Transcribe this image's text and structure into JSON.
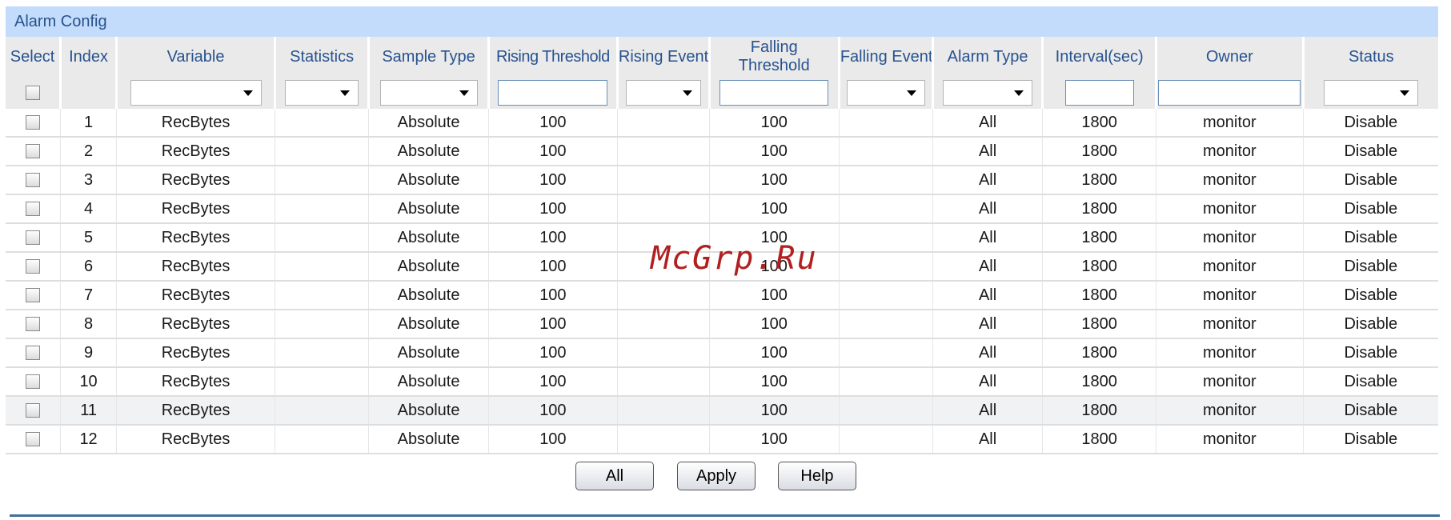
{
  "panel": {
    "title": "Alarm Config"
  },
  "columns": {
    "select": "Select",
    "index": "Index",
    "variable": "Variable",
    "statistics": "Statistics",
    "sample_type": "Sample Type",
    "rising_threshold": "Rising Threshold",
    "rising_event": "Rising Event",
    "falling_threshold_1": "Falling",
    "falling_threshold_2": "Threshold",
    "falling_event": "Falling Event",
    "alarm_type": "Alarm Type",
    "interval": "Interval(sec)",
    "owner": "Owner",
    "status": "Status"
  },
  "filters": {
    "variable": "",
    "statistics": "",
    "sample_type": "",
    "rising_threshold": "",
    "rising_event": "",
    "falling_threshold": "",
    "falling_event": "",
    "alarm_type": "",
    "interval": "",
    "owner": "",
    "status": ""
  },
  "rows": [
    {
      "index": "1",
      "variable": "RecBytes",
      "statistics": "",
      "sample_type": "Absolute",
      "rising_threshold": "100",
      "rising_event": "",
      "falling_threshold": "100",
      "falling_event": "",
      "alarm_type": "All",
      "interval": "1800",
      "owner": "monitor",
      "status": "Disable"
    },
    {
      "index": "2",
      "variable": "RecBytes",
      "statistics": "",
      "sample_type": "Absolute",
      "rising_threshold": "100",
      "rising_event": "",
      "falling_threshold": "100",
      "falling_event": "",
      "alarm_type": "All",
      "interval": "1800",
      "owner": "monitor",
      "status": "Disable"
    },
    {
      "index": "3",
      "variable": "RecBytes",
      "statistics": "",
      "sample_type": "Absolute",
      "rising_threshold": "100",
      "rising_event": "",
      "falling_threshold": "100",
      "falling_event": "",
      "alarm_type": "All",
      "interval": "1800",
      "owner": "monitor",
      "status": "Disable"
    },
    {
      "index": "4",
      "variable": "RecBytes",
      "statistics": "",
      "sample_type": "Absolute",
      "rising_threshold": "100",
      "rising_event": "",
      "falling_threshold": "100",
      "falling_event": "",
      "alarm_type": "All",
      "interval": "1800",
      "owner": "monitor",
      "status": "Disable"
    },
    {
      "index": "5",
      "variable": "RecBytes",
      "statistics": "",
      "sample_type": "Absolute",
      "rising_threshold": "100",
      "rising_event": "",
      "falling_threshold": "100",
      "falling_event": "",
      "alarm_type": "All",
      "interval": "1800",
      "owner": "monitor",
      "status": "Disable"
    },
    {
      "index": "6",
      "variable": "RecBytes",
      "statistics": "",
      "sample_type": "Absolute",
      "rising_threshold": "100",
      "rising_event": "",
      "falling_threshold": "100",
      "falling_event": "",
      "alarm_type": "All",
      "interval": "1800",
      "owner": "monitor",
      "status": "Disable"
    },
    {
      "index": "7",
      "variable": "RecBytes",
      "statistics": "",
      "sample_type": "Absolute",
      "rising_threshold": "100",
      "rising_event": "",
      "falling_threshold": "100",
      "falling_event": "",
      "alarm_type": "All",
      "interval": "1800",
      "owner": "monitor",
      "status": "Disable"
    },
    {
      "index": "8",
      "variable": "RecBytes",
      "statistics": "",
      "sample_type": "Absolute",
      "rising_threshold": "100",
      "rising_event": "",
      "falling_threshold": "100",
      "falling_event": "",
      "alarm_type": "All",
      "interval": "1800",
      "owner": "monitor",
      "status": "Disable"
    },
    {
      "index": "9",
      "variable": "RecBytes",
      "statistics": "",
      "sample_type": "Absolute",
      "rising_threshold": "100",
      "rising_event": "",
      "falling_threshold": "100",
      "falling_event": "",
      "alarm_type": "All",
      "interval": "1800",
      "owner": "monitor",
      "status": "Disable"
    },
    {
      "index": "10",
      "variable": "RecBytes",
      "statistics": "",
      "sample_type": "Absolute",
      "rising_threshold": "100",
      "rising_event": "",
      "falling_threshold": "100",
      "falling_event": "",
      "alarm_type": "All",
      "interval": "1800",
      "owner": "monitor",
      "status": "Disable"
    },
    {
      "index": "11",
      "variable": "RecBytes",
      "statistics": "",
      "sample_type": "Absolute",
      "rising_threshold": "100",
      "rising_event": "",
      "falling_threshold": "100",
      "falling_event": "",
      "alarm_type": "All",
      "interval": "1800",
      "owner": "monitor",
      "status": "Disable",
      "highlighted": true
    },
    {
      "index": "12",
      "variable": "RecBytes",
      "statistics": "",
      "sample_type": "Absolute",
      "rising_threshold": "100",
      "rising_event": "",
      "falling_threshold": "100",
      "falling_event": "",
      "alarm_type": "All",
      "interval": "1800",
      "owner": "monitor",
      "status": "Disable"
    }
  ],
  "buttons": {
    "all": "All",
    "apply": "Apply",
    "help": "Help"
  },
  "watermark": "McGrp.Ru",
  "colors": {
    "title_bg": "#c4dcfb",
    "header_text": "#27528f",
    "rule": "#3f6f9a"
  }
}
